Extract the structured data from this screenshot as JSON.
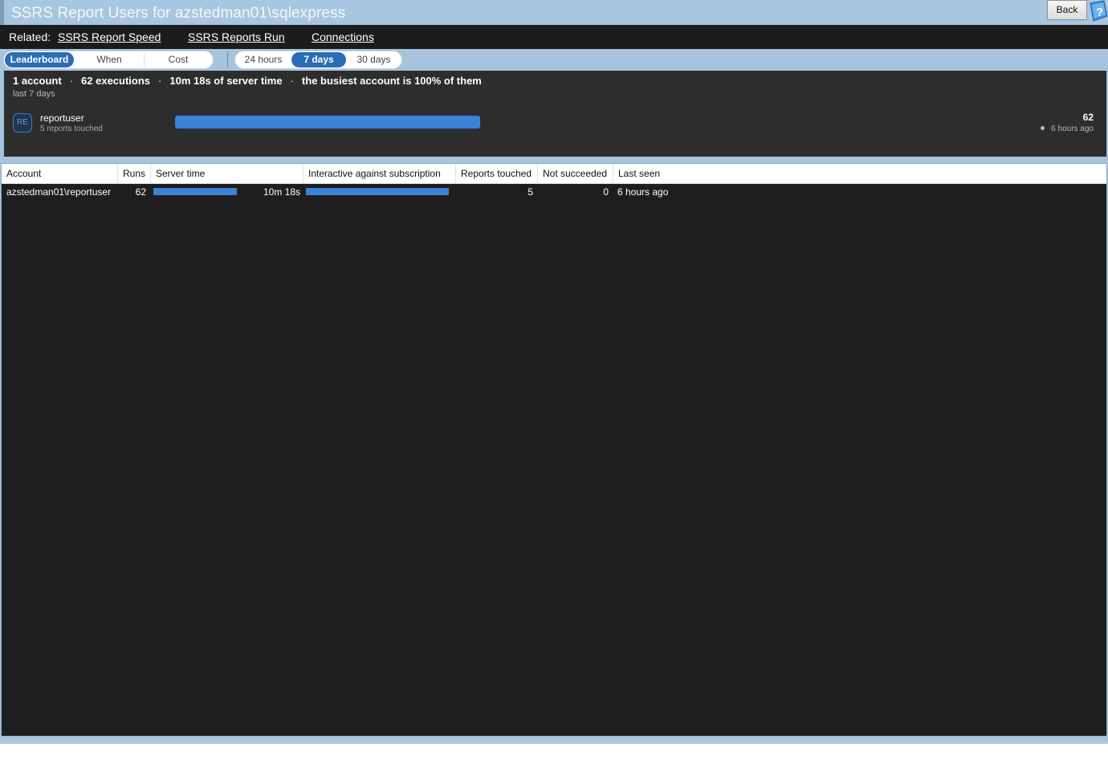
{
  "window": {
    "title": "SSRS Report Users for azstedman01\\sqlexpress",
    "back_label": "Back"
  },
  "related": {
    "label": "Related:",
    "links": [
      "SSRS Report Speed",
      "SSRS Reports Run",
      "Connections"
    ]
  },
  "view_tabs": {
    "options": [
      "Leaderboard",
      "When",
      "Cost"
    ],
    "selected": "Leaderboard"
  },
  "range_tabs": {
    "options": [
      "24 hours",
      "7 days",
      "30 days"
    ],
    "selected": "7 days"
  },
  "summary": {
    "accounts": "1 account",
    "executions": "62 executions",
    "server_time": "10m 18s of server time",
    "busiest": "the busiest account is 100% of them",
    "separator": "·",
    "period": "last 7 days",
    "leader": {
      "initials": "RE",
      "name": "reportuser",
      "subtitle": "5 reports touched",
      "count": "62",
      "last_seen": "6 hours ago",
      "share": 1.0
    }
  },
  "grid": {
    "columns": [
      "Account",
      "Runs",
      "Server time",
      "Interactive against subscription",
      "Reports touched",
      "Not succeeded",
      "Last seen"
    ],
    "rows": [
      {
        "account": "azstedman01\\reportuser",
        "runs": "62",
        "runs_fraction": 1.0,
        "server_time": "10m 18s",
        "interactive_fraction": 1.0,
        "reports_touched": "5",
        "not_succeeded": "0",
        "last_seen": "6 hours ago"
      }
    ]
  },
  "colors": {
    "accent": "#2b6cb4",
    "bar": "#3a82d8",
    "panel": "#2d2d2d",
    "grid_bg": "#1e1e1e",
    "titlebar": "#a8c6df"
  }
}
